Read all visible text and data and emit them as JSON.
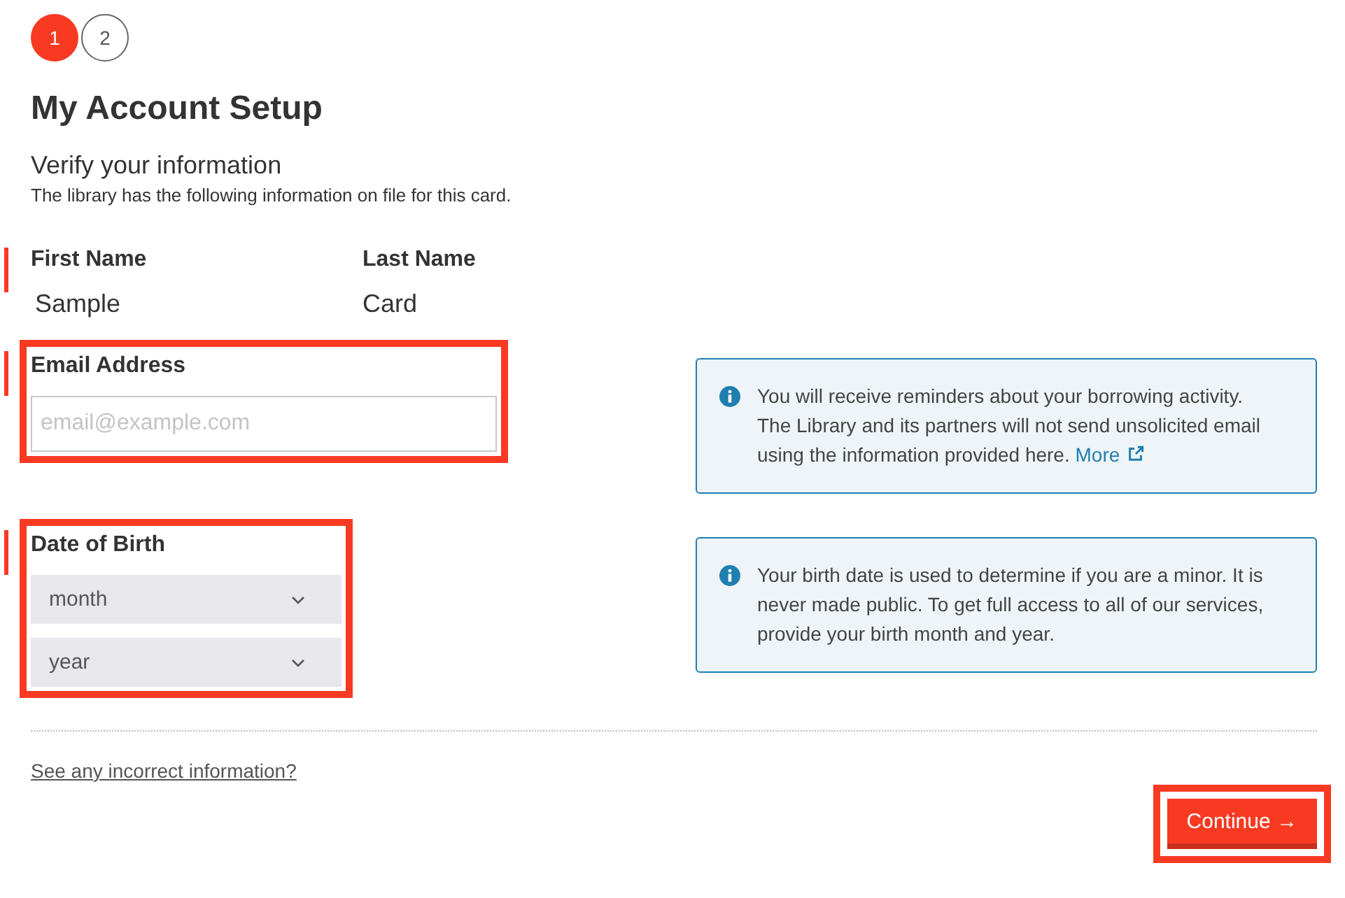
{
  "steps": [
    {
      "label": "1",
      "selected": true
    },
    {
      "label": "2",
      "selected": false
    }
  ],
  "title": "My Account Setup",
  "section": {
    "heading": "Verify your information",
    "description": "The library has the following information on file for this card."
  },
  "names": {
    "required": true,
    "fields": [
      {
        "label": "First Name",
        "value": "Sample"
      },
      {
        "label": "Last Name",
        "value": "Card"
      }
    ]
  },
  "email": {
    "label": "Email Address",
    "placeholder": "email@example.com",
    "required": true,
    "highlighted": true,
    "info": {
      "text": "You will receive reminders about your borrowing activity. The Library and its partners will not send unsolicited email using the information provided here.",
      "link": "More"
    }
  },
  "birth_date": {
    "label": "Date of Birth",
    "required": true,
    "highlighted": true,
    "selects": [
      {
        "value": "month"
      },
      {
        "value": "year"
      }
    ],
    "info": {
      "text": "Your birth date is used to determine if you are a minor. It is never made public. To get full access to all of our services, provide your birth month and year."
    }
  },
  "help_link": "See any incorrect information?",
  "continue_button": {
    "label": "Continue",
    "icon": "→",
    "highlighted": true
  }
}
